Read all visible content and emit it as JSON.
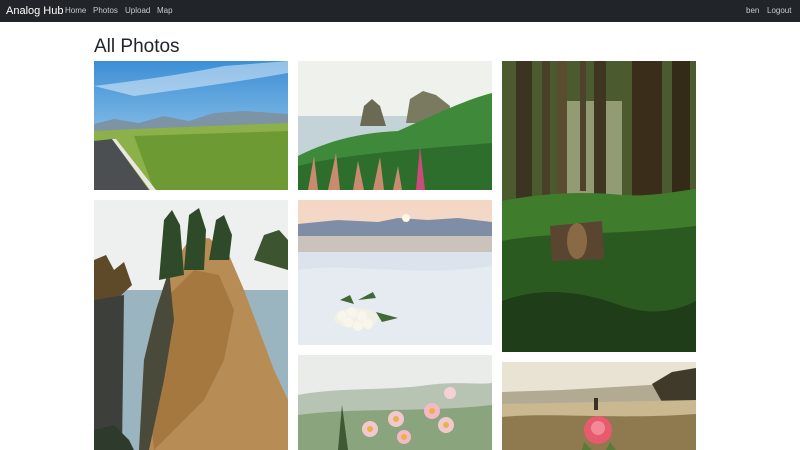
{
  "navbar": {
    "brand": "Analog Hub",
    "links": [
      "Home",
      "Photos",
      "Upload",
      "Map"
    ],
    "user": "ben",
    "logout": "Logout"
  },
  "page": {
    "title": "All Photos"
  },
  "photos": [
    "road-hills-photo",
    "coastal-rocks-flowers-photo",
    "forest-trees-photo",
    "rocky-cliff-trees-photo",
    "white-roses-dunes-photo",
    "pink-flowers-meadow-photo",
    "pink-flower-beach-photo"
  ],
  "colors": {
    "navbar_bg": "#212529",
    "nav_link": "#c7cbcf",
    "title": "#212529"
  }
}
